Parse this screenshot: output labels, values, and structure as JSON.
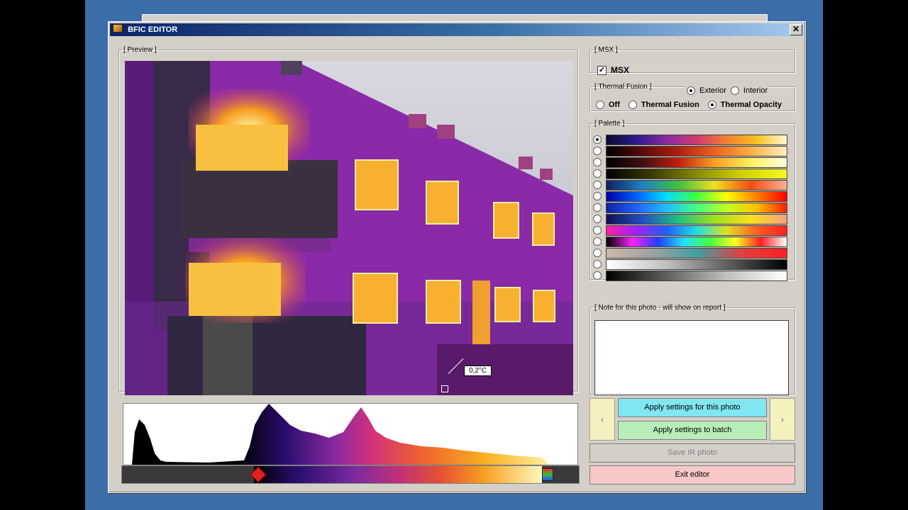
{
  "window": {
    "title": "BFIC EDITOR",
    "close_glyph": "✕"
  },
  "preview": {
    "legend": "[ Preview ]",
    "temperature_readout": "0,2°C"
  },
  "msx": {
    "legend": "[ MSX ]",
    "label": "MSX",
    "checked": true
  },
  "fusion": {
    "legend": "[ Thermal Fusion ]",
    "exterior_label": "Exterior",
    "interior_label": "Interior",
    "selected_location": "Exterior",
    "modes": [
      "Off",
      "Thermal Fusion",
      "Thermal Opacity"
    ],
    "selected_mode": "Thermal Opacity"
  },
  "palette": {
    "legend": "[ Palette ]",
    "selected_index": 0,
    "gradients": [
      "linear-gradient(90deg,#0a0a30,#2a1a8a,#8a2aa0,#d03a70,#f08030,#f8c020,#fff8d0)",
      "linear-gradient(90deg,#000,#5a0a0a,#b02010,#f06020,#f8b040,#fff0c0)",
      "linear-gradient(90deg,#000,#401010,#c02010,#f8a020,#fff060,#fffde0)",
      "linear-gradient(90deg,#000,#3a3a00,#8a8a00,#d0d000,#f8f820)",
      "linear-gradient(90deg,#102060,#2080c0,#40c040,#f0e020,#f05010,#f8b090)",
      "linear-gradient(90deg,#0000a0,#0060ff,#00e0ff,#40ff40,#ffff00,#ff8000,#ff0000)",
      "linear-gradient(90deg,#1020a0,#2060ff,#20c0ff,#40ff80,#c0ff20,#ffc000,#ff2000)",
      "linear-gradient(90deg,#101050,#2050c0,#20c080,#a0e020,#f8e020,#f8a080)",
      "linear-gradient(90deg,#ff20a0,#a020ff,#2060ff,#20e0e0,#e0e020,#ff6020,#ff2020)",
      "linear-gradient(90deg,#000,#ff20ff,#2040ff,#20e0ff,#40ff40,#ffff20,#ff2020,#ffffff)",
      "linear-gradient(90deg,#d0b8a8,#a0a0a0,#40a0a0,#e04040,#ff2020)",
      "linear-gradient(90deg,#ffffff,#c0c0c0,#606060,#000000)",
      "linear-gradient(90deg,#000000,#606060,#c0c0c0,#ffffff)"
    ]
  },
  "note": {
    "legend": "[ Note for this photo - will show on report ]",
    "value": ""
  },
  "buttons": {
    "prev": "‹",
    "next": "›",
    "apply_photo": "Apply settings for this photo",
    "apply_batch": "Apply settings to batch",
    "save_ir": "Save IR photo",
    "exit": "Exit editor"
  },
  "colors": {
    "accent_cyan": "#7fe6f2",
    "accent_green": "#b8eeb8",
    "accent_pink": "#f8c8c8",
    "titlebar": "#0a246a"
  }
}
